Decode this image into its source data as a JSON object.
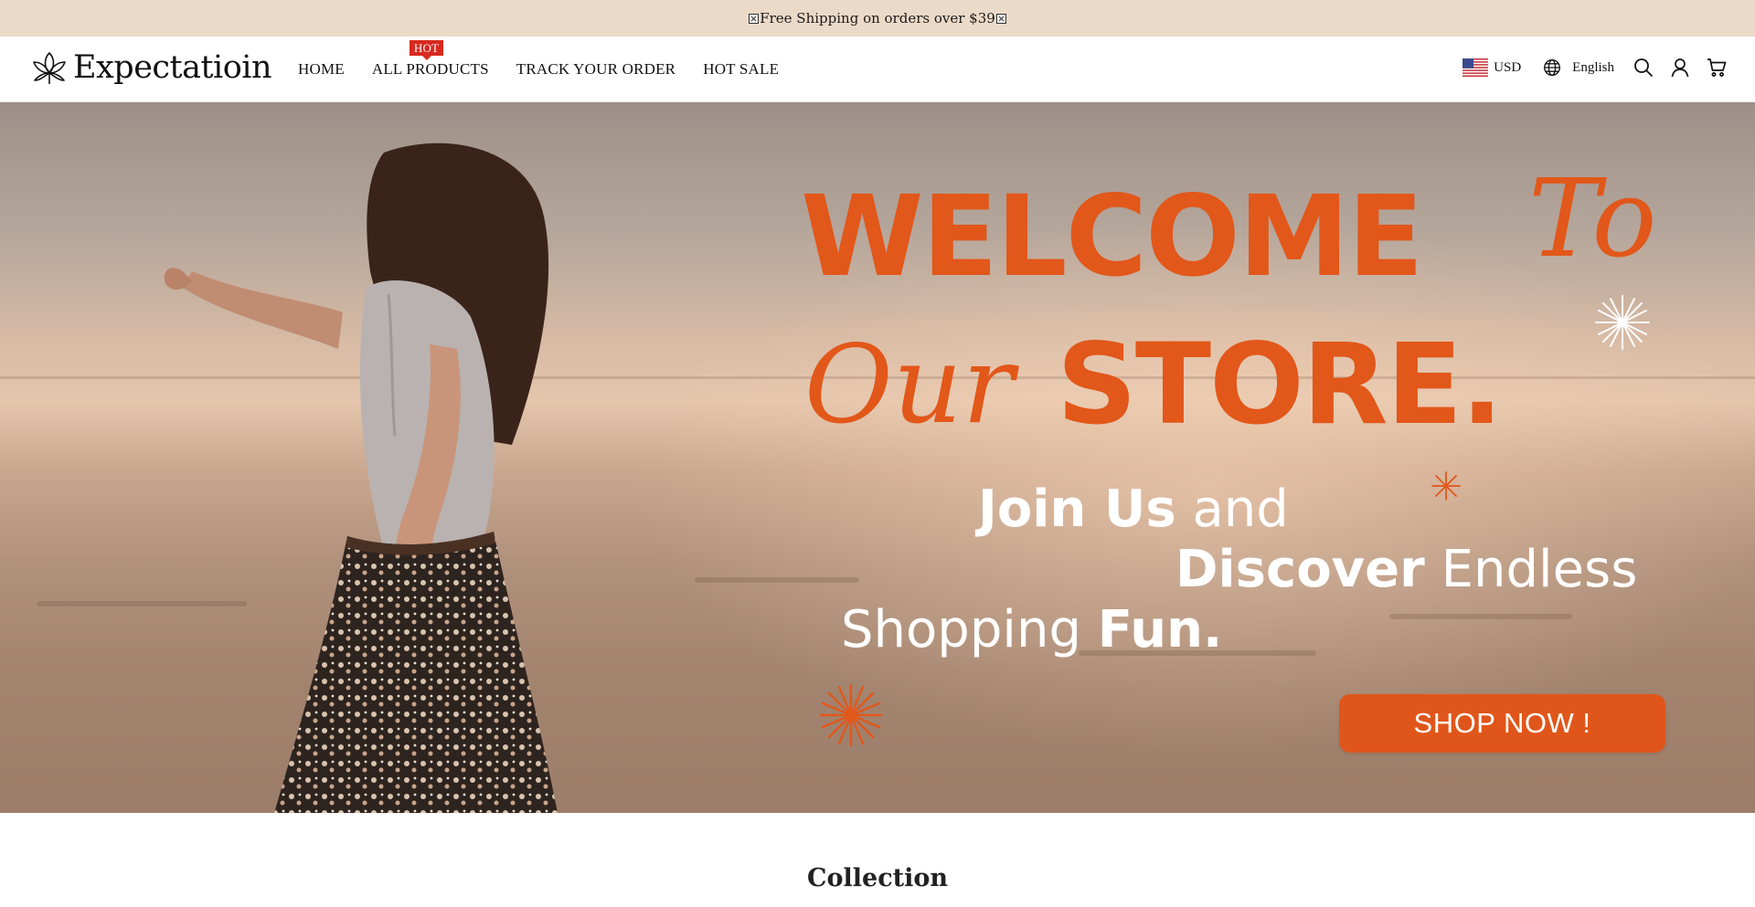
{
  "announcement": {
    "text": "Free Shipping on orders over $39"
  },
  "header": {
    "logo_text": "Expectatioin",
    "nav": [
      {
        "label": "HOME"
      },
      {
        "label": "ALL PRODUCTS",
        "badge": "HOT"
      },
      {
        "label": "TRACK YOUR ORDER"
      },
      {
        "label": "HOT SALE"
      }
    ],
    "currency": "USD",
    "language": "English",
    "icons": [
      "globe-icon",
      "search-icon",
      "account-icon",
      "cart-icon"
    ]
  },
  "hero": {
    "headline_1": "WELCOME",
    "headline_script_1": "To",
    "headline_script_2": "Our",
    "headline_2": "STORE.",
    "tagline_1_bold": "Join Us",
    "tagline_1_regular": " and",
    "tagline_2_bold": "Discover",
    "tagline_2_regular": " Endless",
    "tagline_3_regular": "Shopping ",
    "tagline_3_bold": "Fun.",
    "cta_label": "SHOP NOW !",
    "accent_color": "#e2571a"
  },
  "collection": {
    "title": "Collection"
  }
}
